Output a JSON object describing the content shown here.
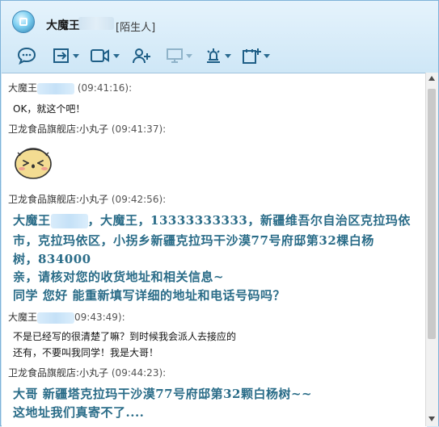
{
  "window": {
    "contact_name": "大魔王",
    "contact_tag": "[陌生人]"
  },
  "toolbar": {
    "icons": [
      "chat-bubble-icon",
      "file-transfer-icon",
      "video-call-icon",
      "add-friend-icon",
      "screen-share-icon",
      "remote-assist-icon",
      "app-add-icon"
    ]
  },
  "messages": [
    {
      "sender": "大魔王",
      "time": "(09:41:16):",
      "lines": [
        "OK，就这个吧！"
      ]
    },
    {
      "sender": "卫龙食品旗舰店:小丸子",
      "time": "(09:41:37):",
      "emoji": "blushing-face"
    },
    {
      "sender": "卫龙食品旗舰店:小丸子",
      "time": "(09:42:56):",
      "hw_line1_prefix": "大魔王",
      "hw_lines": [
        "，大魔王，13333333333，新疆维吾尔自治区克拉玛依",
        "市，克拉玛依区，小拐乡新疆克拉玛干沙漠77号府邸第32棵白杨",
        "树，834000",
        "亲，请核对您的收货地址和相关信息~",
        "同学    您好     能重新填写详细的地址和电话号码吗？"
      ]
    },
    {
      "sender": "大魔王",
      "time": "09:43:49):",
      "lines": [
        "不是已经写的很清楚了嘛？到时候我会派人去接应的",
        "还有，不要叫我同学！我是大哥！"
      ]
    },
    {
      "sender": "卫龙食品旗舰店:小丸子",
      "time": "(09:44:23):",
      "hw_lines": [
        "大哥      新疆塔克拉玛干沙漠77号府邸第32颗白杨树~~",
        "这地址我们真寄不了...."
      ]
    }
  ]
}
